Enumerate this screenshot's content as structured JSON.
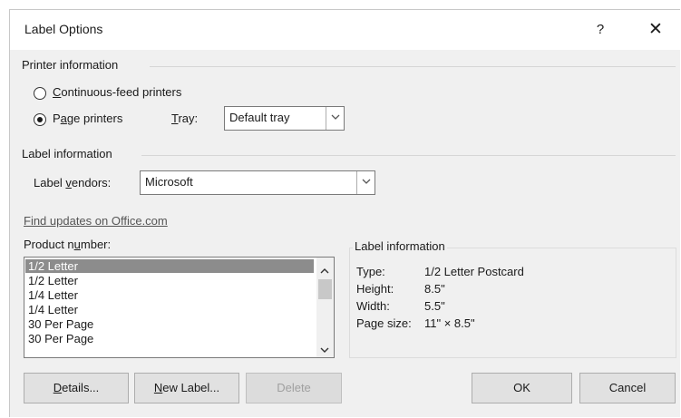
{
  "dialog": {
    "title": "Label Options",
    "help_label": "?",
    "close_label": "✕"
  },
  "printer_info": {
    "heading": "Printer information",
    "continuous": {
      "label_pre": "",
      "label_key": "C",
      "label_post": "ontinuous-feed printers",
      "checked": false
    },
    "page": {
      "label_pre": "P",
      "label_key": "a",
      "label_post": "ge printers",
      "checked": true
    },
    "tray": {
      "label_pre": "",
      "label_key": "T",
      "label_post": "ray:",
      "value": "Default tray"
    }
  },
  "label_info": {
    "heading": "Label information",
    "vendors": {
      "label_pre": "Label ",
      "label_key": "v",
      "label_post": "endors:",
      "value": "Microsoft"
    },
    "find_updates_link": "Find updates on Office.com"
  },
  "product_number": {
    "label_pre": "Product n",
    "label_key": "u",
    "label_post": "mber:",
    "items": [
      "1/2 Letter",
      "1/2 Letter",
      "1/4 Letter",
      "1/4 Letter",
      "30 Per Page",
      "30 Per Page"
    ],
    "selected_index": 0
  },
  "label_details": {
    "heading": "Label information",
    "rows": [
      {
        "key": "Type:",
        "value": "1/2 Letter Postcard"
      },
      {
        "key": "Height:",
        "value": "8.5\""
      },
      {
        "key": "Width:",
        "value": "5.5\""
      },
      {
        "key": "Page size:",
        "value": "11\" × 8.5\""
      }
    ]
  },
  "buttons": {
    "details": {
      "label_key": "D",
      "label_post": "etails..."
    },
    "new_label": {
      "label_key": "N",
      "label_post": "ew Label..."
    },
    "delete": "Delete",
    "ok": "OK",
    "cancel": "Cancel"
  },
  "colors": {
    "dialog_bg": "#f0f0f0",
    "selection_bg": "#8c8c8c",
    "link": "#555555"
  }
}
